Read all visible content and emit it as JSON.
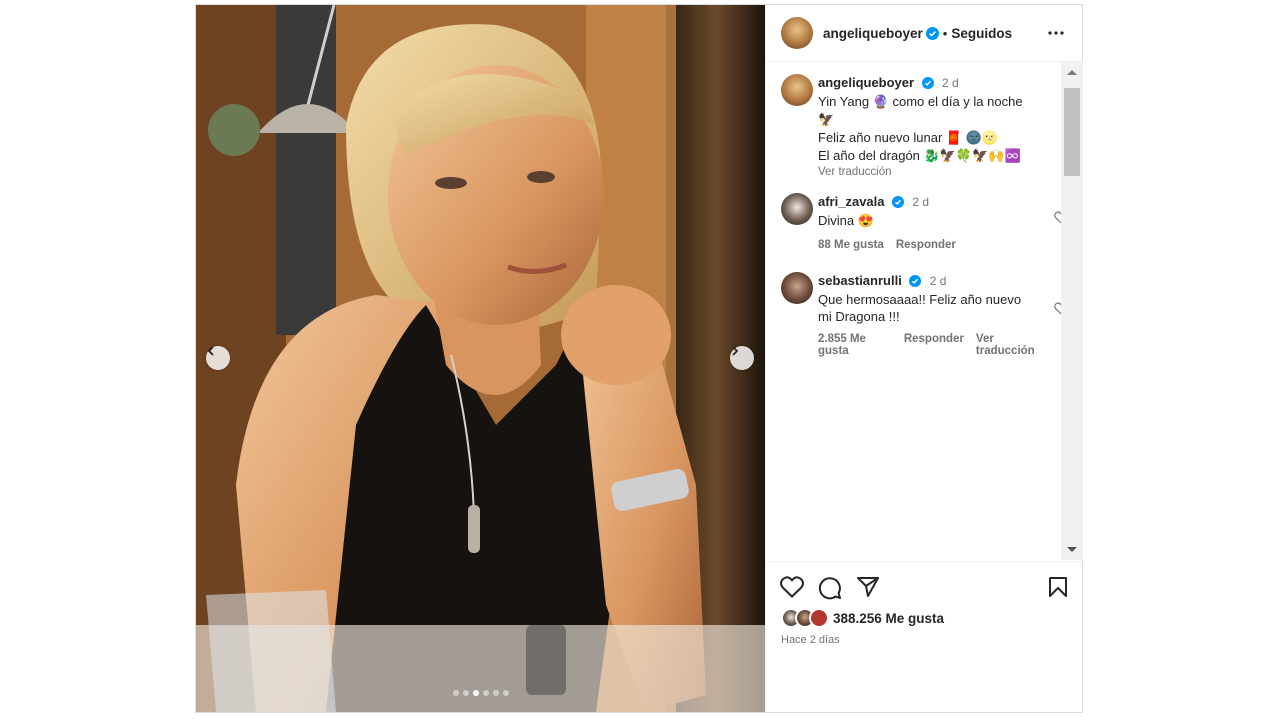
{
  "post": {
    "author": "angeliqueboyer",
    "separator": "•",
    "follow_status": "Seguidos",
    "carousel": {
      "total": 6,
      "active": 2
    }
  },
  "caption": {
    "username": "angeliqueboyer",
    "time": "2 d",
    "lines": [
      "Yin Yang 🔮 como el día y la noche",
      "🦅",
      "Feliz año nuevo lunar 🧧 🌚🌝",
      "El año del dragón 🐉🦅🍀🦅🙌♾️"
    ],
    "translate": "Ver traducción"
  },
  "comments": [
    {
      "username": "afri_zavala",
      "time": "2 d",
      "text": "Divina 😍",
      "likes": "88 Me gusta",
      "reply": "Responder"
    },
    {
      "username": "sebastianrulli",
      "time": "2 d",
      "text": "Que hermosaaaa!! Feliz año nuevo mi Dragona !!!",
      "likes": "2.855 Me gusta",
      "reply": "Responder",
      "translate": "Ver traducción"
    }
  ],
  "footer": {
    "likes": "388.256 Me gusta",
    "time_ago": "Hace 2 días"
  },
  "icons": {
    "verified": "verified-badge-icon",
    "more": "more-options-icon",
    "like": "heart-icon",
    "comment": "comment-bubble-icon",
    "share": "paper-plane-icon",
    "save": "bookmark-icon"
  },
  "colors": {
    "verified": "#0095f6",
    "text": "#262626",
    "muted": "#737373"
  }
}
